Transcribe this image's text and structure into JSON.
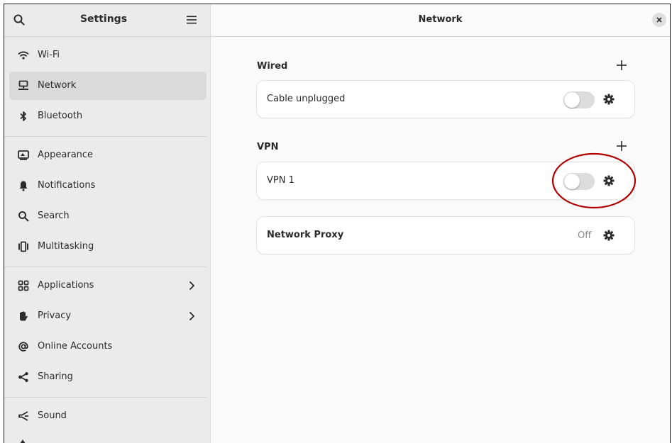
{
  "sidebar": {
    "title": "Settings",
    "items": [
      {
        "label": "Wi-Fi",
        "icon": "wifi-icon"
      },
      {
        "label": "Network",
        "icon": "network-icon",
        "selected": true
      },
      {
        "label": "Bluetooth",
        "icon": "bluetooth-icon"
      },
      {
        "label": "Appearance",
        "icon": "appearance-icon"
      },
      {
        "label": "Notifications",
        "icon": "bell-icon"
      },
      {
        "label": "Search",
        "icon": "search-icon"
      },
      {
        "label": "Multitasking",
        "icon": "multitasking-icon"
      },
      {
        "label": "Applications",
        "icon": "applications-icon",
        "has_submenu": true
      },
      {
        "label": "Privacy",
        "icon": "hand-icon",
        "has_submenu": true
      },
      {
        "label": "Online Accounts",
        "icon": "at-icon"
      },
      {
        "label": "Sharing",
        "icon": "share-icon"
      },
      {
        "label": "Sound",
        "icon": "speaker-icon"
      }
    ]
  },
  "main": {
    "title": "Network",
    "wired": {
      "section_title": "Wired",
      "row_label": "Cable unplugged",
      "toggle_on": false
    },
    "vpn": {
      "section_title": "VPN",
      "row_label": "VPN 1",
      "toggle_on": false
    },
    "proxy": {
      "row_label": "Network Proxy",
      "status": "Off"
    }
  },
  "colors": {
    "sidebar_bg": "#ebebeb",
    "selected_bg": "#dadada",
    "main_bg": "#fafafa",
    "annotation": "#b00000"
  }
}
